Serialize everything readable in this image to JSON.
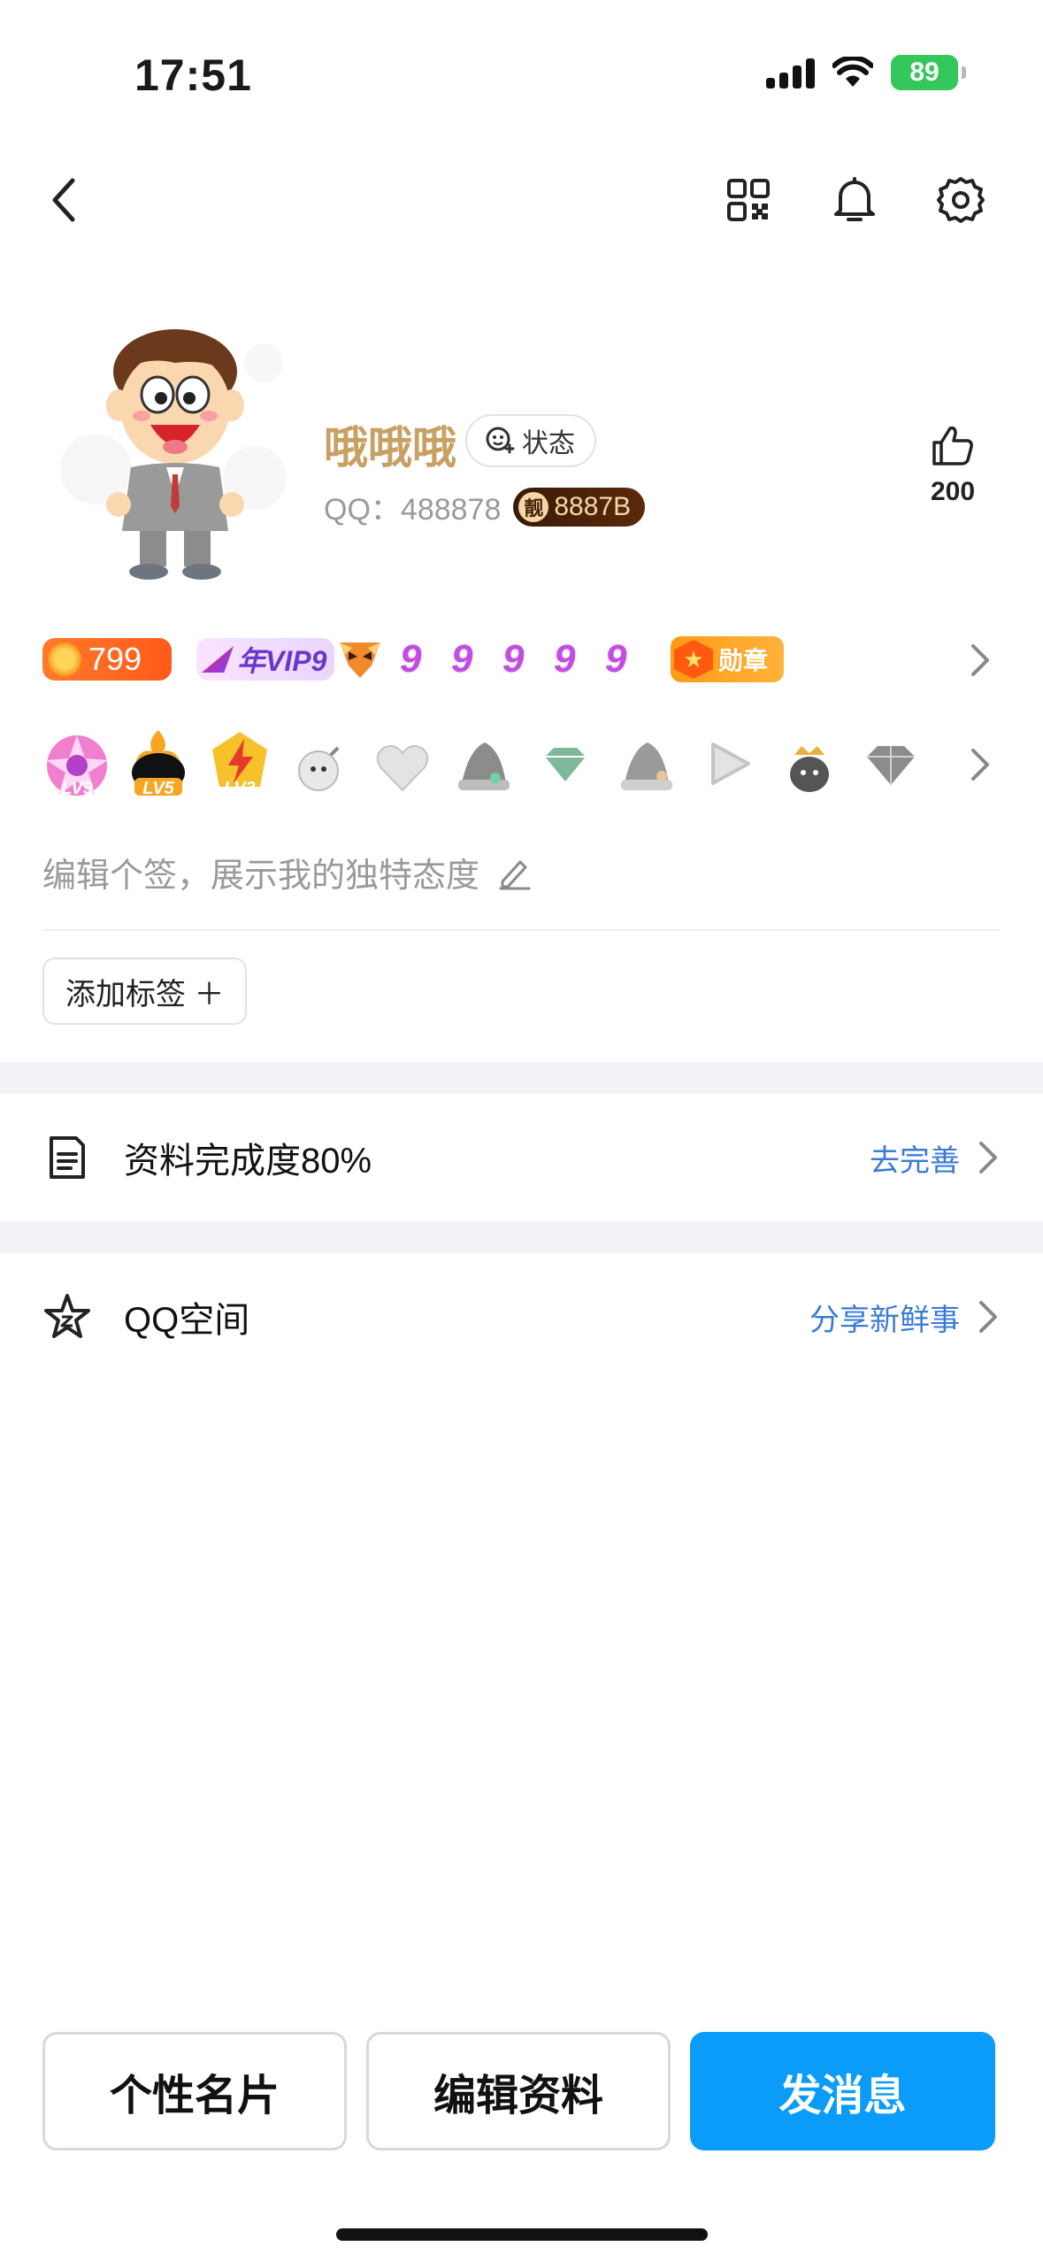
{
  "status_bar": {
    "time": "17:51",
    "battery": "89"
  },
  "profile": {
    "nickname": "哦哦哦",
    "status_label": "状态",
    "qq_label": "QQ：",
    "qq_number": "488878",
    "pretty_badge_icon": "靓",
    "pretty_badge_text": "8887B",
    "likes": "200"
  },
  "badges_row1": {
    "coin_value": "799",
    "vip_label": "年VIP9",
    "swirl_char": "9",
    "medal_label": "勋章"
  },
  "badges_row2": {
    "lv_labels": [
      "LV9",
      "LV5",
      "LV3"
    ]
  },
  "signature": {
    "placeholder": "编辑个签，展示我的独特态度"
  },
  "tag_button": {
    "label": "添加标签 ＋"
  },
  "sections": [
    {
      "icon": "document-icon",
      "label": "资料完成度80%",
      "action": "去完善"
    },
    {
      "icon": "star-icon",
      "label": "QQ空间",
      "action": "分享新鲜事"
    }
  ],
  "bottom_buttons": {
    "card": "个性名片",
    "edit": "编辑资料",
    "message": "发消息"
  },
  "colors": {
    "primary": "#0a9cf8",
    "link": "#3b7bd4",
    "nickname": "#c9a063",
    "battery": "#34c759"
  }
}
